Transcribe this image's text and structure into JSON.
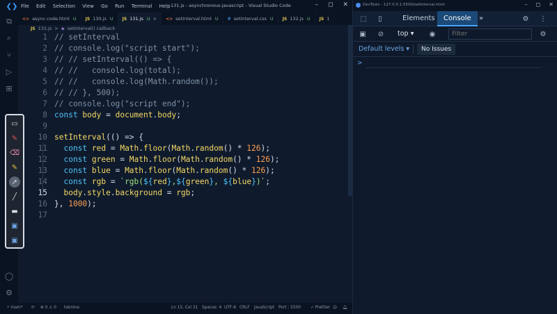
{
  "vscode": {
    "menu": [
      "File",
      "Edit",
      "Selection",
      "View",
      "Go",
      "Run",
      "Terminal",
      "Help"
    ],
    "window_title": "131.js - asynchronous-javascript - Visual Studio Code",
    "window_controls": [
      "–",
      "◻",
      "✕"
    ],
    "tabs": [
      {
        "icon": "<>",
        "label": "async-code.html",
        "modified": "U"
      },
      {
        "icon": "JS",
        "label": "130.js",
        "modified": "U"
      },
      {
        "icon": "JS",
        "label": "131.js",
        "modified": "U",
        "active": true
      },
      {
        "icon": "<>",
        "label": "setInterval.html",
        "modified": "U"
      },
      {
        "icon": "#",
        "label": "setInterval.css",
        "modified": "U"
      },
      {
        "icon": "JS",
        "label": "132.js",
        "modified": "U"
      },
      {
        "icon": "JS",
        "label": "1"
      }
    ],
    "breadcrumb": {
      "file_icon": "JS",
      "file": "131.js",
      "sep": ">",
      "symbol": "setInterval() callback"
    },
    "code_lines": [
      {
        "n": "1",
        "tokens": [
          {
            "t": "// setInterval",
            "c": "comment"
          }
        ]
      },
      {
        "n": "2",
        "tokens": [
          {
            "t": "// console.log(\"script start\");",
            "c": "comment"
          }
        ]
      },
      {
        "n": "3",
        "tokens": [
          {
            "t": "// // setInterval(() => {",
            "c": "comment"
          }
        ]
      },
      {
        "n": "4",
        "tokens": [
          {
            "t": "// //   console.log(total);",
            "c": "comment"
          }
        ]
      },
      {
        "n": "5",
        "tokens": [
          {
            "t": "// //   console.log(Math.random());",
            "c": "comment"
          }
        ]
      },
      {
        "n": "6",
        "tokens": [
          {
            "t": "// // }, 500);",
            "c": "comment"
          }
        ]
      },
      {
        "n": "7",
        "tokens": [
          {
            "t": "// console.log(\"script end\");",
            "c": "comment"
          }
        ]
      },
      {
        "n": "8",
        "tokens": [
          {
            "t": "const ",
            "c": "kw"
          },
          {
            "t": "body",
            "c": "var"
          },
          {
            "t": " = ",
            "c": "plain"
          },
          {
            "t": "document",
            "c": "var"
          },
          {
            "t": ".",
            "c": "plain"
          },
          {
            "t": "body",
            "c": "var"
          },
          {
            "t": ";",
            "c": "plain"
          }
        ]
      },
      {
        "n": "9",
        "tokens": []
      },
      {
        "n": "10",
        "tokens": [
          {
            "t": "setInterval",
            "c": "fn"
          },
          {
            "t": "(() => {",
            "c": "plain"
          }
        ]
      },
      {
        "n": "11",
        "tokens": [
          {
            "t": "  const ",
            "c": "kw"
          },
          {
            "t": "red",
            "c": "var"
          },
          {
            "t": " = ",
            "c": "plain"
          },
          {
            "t": "Math",
            "c": "var"
          },
          {
            "t": ".",
            "c": "plain"
          },
          {
            "t": "floor",
            "c": "fn"
          },
          {
            "t": "(",
            "c": "plain"
          },
          {
            "t": "Math",
            "c": "var"
          },
          {
            "t": ".",
            "c": "plain"
          },
          {
            "t": "random",
            "c": "fn"
          },
          {
            "t": "() * ",
            "c": "plain"
          },
          {
            "t": "126",
            "c": "num"
          },
          {
            "t": ");",
            "c": "plain"
          }
        ]
      },
      {
        "n": "12",
        "tokens": [
          {
            "t": "  const ",
            "c": "kw"
          },
          {
            "t": "green",
            "c": "var"
          },
          {
            "t": " = ",
            "c": "plain"
          },
          {
            "t": "Math",
            "c": "var"
          },
          {
            "t": ".",
            "c": "plain"
          },
          {
            "t": "floor",
            "c": "fn"
          },
          {
            "t": "(",
            "c": "plain"
          },
          {
            "t": "Math",
            "c": "var"
          },
          {
            "t": ".",
            "c": "plain"
          },
          {
            "t": "random",
            "c": "fn"
          },
          {
            "t": "() * ",
            "c": "plain"
          },
          {
            "t": "126",
            "c": "num"
          },
          {
            "t": ");",
            "c": "plain"
          }
        ]
      },
      {
        "n": "13",
        "tokens": [
          {
            "t": "  const ",
            "c": "kw"
          },
          {
            "t": "blue",
            "c": "var"
          },
          {
            "t": " = ",
            "c": "plain"
          },
          {
            "t": "Math",
            "c": "var"
          },
          {
            "t": ".",
            "c": "plain"
          },
          {
            "t": "floor",
            "c": "fn"
          },
          {
            "t": "(",
            "c": "plain"
          },
          {
            "t": "Math",
            "c": "var"
          },
          {
            "t": ".",
            "c": "plain"
          },
          {
            "t": "random",
            "c": "fn"
          },
          {
            "t": "() * ",
            "c": "plain"
          },
          {
            "t": "126",
            "c": "num"
          },
          {
            "t": ");",
            "c": "plain"
          }
        ]
      },
      {
        "n": "14",
        "tokens": [
          {
            "t": "  const ",
            "c": "kw"
          },
          {
            "t": "rgb",
            "c": "var"
          },
          {
            "t": " = ",
            "c": "plain"
          },
          {
            "t": "`rgb(",
            "c": "str"
          },
          {
            "t": "${",
            "c": "kw"
          },
          {
            "t": "red",
            "c": "var"
          },
          {
            "t": "}",
            "c": "kw"
          },
          {
            "t": ",",
            "c": "str"
          },
          {
            "t": "${",
            "c": "kw"
          },
          {
            "t": "green",
            "c": "var"
          },
          {
            "t": "}",
            "c": "kw"
          },
          {
            "t": ", ",
            "c": "str"
          },
          {
            "t": "${",
            "c": "kw"
          },
          {
            "t": "blue",
            "c": "var"
          },
          {
            "t": "}",
            "c": "kw"
          },
          {
            "t": ")`",
            "c": "str"
          },
          {
            "t": ";",
            "c": "plain"
          }
        ]
      },
      {
        "n": "15",
        "current": true,
        "tokens": [
          {
            "t": "  body",
            "c": "var"
          },
          {
            "t": ".",
            "c": "plain"
          },
          {
            "t": "style",
            "c": "var"
          },
          {
            "t": ".",
            "c": "plain"
          },
          {
            "t": "background",
            "c": "var"
          },
          {
            "t": " = ",
            "c": "plain"
          },
          {
            "t": "rgb",
            "c": "var"
          },
          {
            "t": ";",
            "c": "plain"
          }
        ]
      },
      {
        "n": "16",
        "tokens": [
          {
            "t": "}, ",
            "c": "plain"
          },
          {
            "t": "1000",
            "c": "num"
          },
          {
            "t": ");",
            "c": "plain"
          }
        ]
      },
      {
        "n": "17",
        "tokens": []
      }
    ],
    "status": {
      "branch": "main*",
      "sync": "⟳",
      "problems": "⊗ 0 ⚠ 0",
      "tabnine": "tabnine",
      "position": "Ln 15, Col 31",
      "spaces": "Spaces: 4",
      "encoding": "UTF-8",
      "eol": "CRLF",
      "language": "JavaScript",
      "port": "Port : 5500",
      "formatter": "✓ Prettier"
    }
  },
  "devtools": {
    "window_title": "DevTools - 127.0.0.1:5500/setInterval.html",
    "window_controls": [
      "–",
      "◻",
      "✕"
    ],
    "tabs": [
      "Elements",
      "Console"
    ],
    "active_tab": "Console",
    "more": "»",
    "context": "top ▾",
    "filter_placeholder": "Filter",
    "levels": "Default levels ▾",
    "issues": "No Issues",
    "prompt": ">"
  },
  "colors": {
    "editor_bg": "#0f1b2d",
    "comment": "#7f8fa6",
    "keyword": "#4fc3f7",
    "identifier": "#f6d864",
    "number": "#ff9e4f",
    "string": "#9ee37d",
    "console_tab": "#1b4a78"
  }
}
